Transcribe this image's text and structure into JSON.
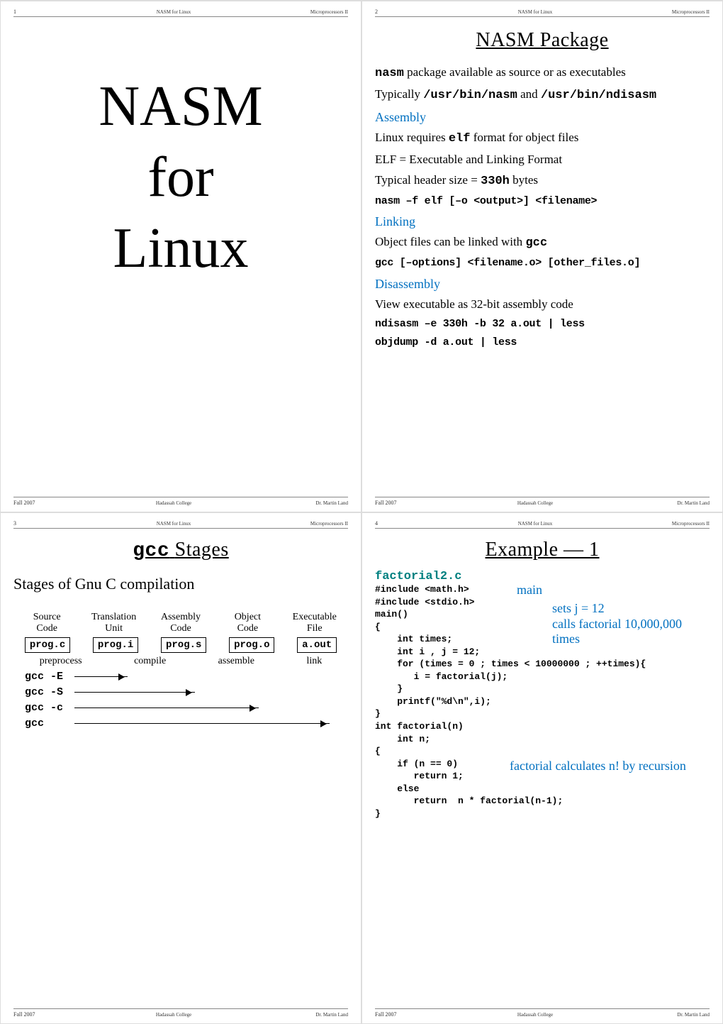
{
  "meta": {
    "hdr_center": "NASM for Linux",
    "hdr_right": "Microprocessors II",
    "ftr_left": "Fall 2007",
    "ftr_center": "Hadassah College",
    "ftr_right": "Dr. Martin Land"
  },
  "pages": {
    "p1": "1",
    "p2": "2",
    "p3": "3",
    "p4": "4"
  },
  "s1": {
    "line1": "NASM",
    "line2": "for",
    "line3": "Linux"
  },
  "s2": {
    "title": "NASM Package",
    "l1a": "nasm",
    "l1b": " package available as source or as executables",
    "l2a": "Typically ",
    "l2b": "/usr/bin/nasm",
    "l2c": " and ",
    "l2d": "/usr/bin/ndisasm",
    "h1": "Assembly",
    "l3a": "Linux requires ",
    "l3b": "elf",
    "l3c": " format for object files",
    "l4": "ELF = Executable and Linking Format",
    "l5a": "Typical header size = ",
    "l5b": "330h",
    "l5c": "  bytes",
    "cmd1": "nasm –f elf [–o <output>] <filename>",
    "h2": "Linking",
    "l6a": "Object files can be linked with ",
    "l6b": "gcc",
    "cmd2": "gcc [–options] <filename.o> [other_files.o]",
    "h3": "Disassembly",
    "l7": "View executable as 32-bit assembly code",
    "cmd3": "ndisasm –e 330h -b 32 a.out | less",
    "cmd4": "objdump -d a.out | less"
  },
  "s3": {
    "title": "gcc Stages",
    "subtitle": "Stages of Gnu C compilation",
    "stages": [
      "Source\nCode",
      "Translation\nUnit",
      "Assembly\nCode",
      "Object\nCode",
      "Executable\nFile"
    ],
    "files": [
      "prog.c",
      "prog.i",
      "prog.s",
      "prog.o",
      "a.out"
    ],
    "ops": [
      "preprocess",
      "compile",
      "assemble",
      "link"
    ],
    "g1": "gcc -E",
    "g2": "gcc -S",
    "g3": "gcc -c",
    "g4": "gcc"
  },
  "s4": {
    "title": "Example — 1",
    "file": "factorial2.c",
    "code1": "#include <math.h>\n#include <stdio.h>\nmain()\n{\n    int times;\n    int i , j = 12;\n    for (times = 0 ; times < 10000000 ; ++times){\n       i = factorial(j);\n    }\n    printf(\"%d\\n\",i);\n}\nint factorial(n)\n    int n;\n{\n    if (n == 0)\n       return 1;\n    else\n       return  n * factorial(n-1);\n}",
    "note_main": "main",
    "note_set": "sets j = 12",
    "note_calls": "calls factorial 10,000,000 times",
    "note_fact": "factorial calculates n! by recursion"
  }
}
